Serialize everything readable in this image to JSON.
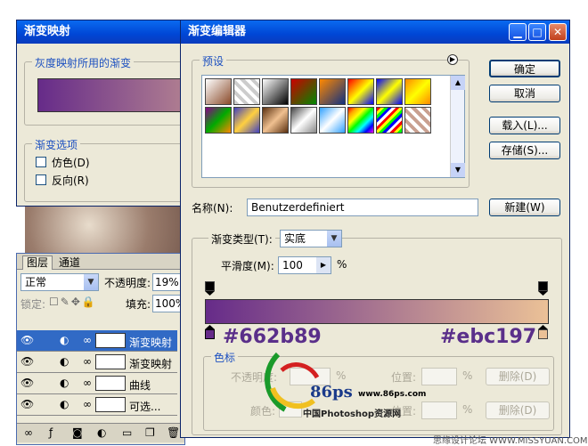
{
  "gradient_map_dialog": {
    "title": "渐变映射",
    "gray_group_label": "灰度映射所用的渐变",
    "options_group_label": "渐变选项",
    "dither_label": "仿色(D)",
    "reverse_label": "反向(R)"
  },
  "layers_panel": {
    "tab_layers": "图层",
    "tab_channels": "通道",
    "blend_mode": "正常",
    "opacity_label": "不透明度:",
    "opacity_value": "19%",
    "lock_label": "锁定:",
    "fill_label": "填充:",
    "fill_value": "100%",
    "layers": [
      {
        "name": "渐变映射",
        "selected": true
      },
      {
        "name": "渐变映射",
        "selected": false
      },
      {
        "name": "曲线",
        "selected": false
      },
      {
        "name": "可选...",
        "selected": false
      }
    ]
  },
  "gradient_editor": {
    "title": "渐变编辑器",
    "presets_label": "预设",
    "ok_label": "确定",
    "cancel_label": "取消",
    "load_label": "载入(L)...",
    "save_label": "存储(S)...",
    "name_label": "名称(N):",
    "name_value": "Benutzerdefiniert",
    "new_label": "新建(W)",
    "type_label": "渐变类型(T):",
    "type_value": "实底",
    "smoothness_label": "平滑度(M):",
    "smoothness_value": "100",
    "smoothness_unit": "%",
    "left_color_label": "#662b89",
    "right_color_label": "#ebc197",
    "stops_group_label": "色标",
    "opacity_label": "不透明度:",
    "location_label": "位置:",
    "delete_label": "删除(D)",
    "color_label": "颜色:",
    "percent": "%"
  },
  "watermark": {
    "site": "www.86ps.com",
    "logo_text": "86ps",
    "name": "中国Photoshop资源网",
    "footer": "思缘设计论坛 WWW.MISSYUAN.COM"
  },
  "colors": {
    "gradient_start": "#662b89",
    "gradient_end": "#ebc197",
    "xp_blue": "#0046d5",
    "dialog_bg": "#ece9d8"
  }
}
